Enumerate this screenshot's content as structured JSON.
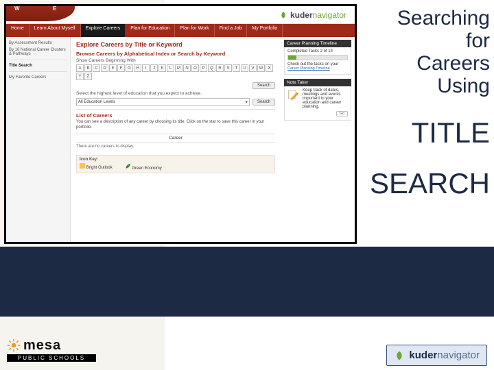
{
  "brand": {
    "name": "kuder",
    "suffix": "navigator"
  },
  "nav": {
    "tabs": [
      {
        "label": "Home"
      },
      {
        "label": "Learn About Myself"
      },
      {
        "label": "Explore Careers",
        "active": true
      },
      {
        "label": "Plan for Education"
      },
      {
        "label": "Plan for Work"
      },
      {
        "label": "Find a Job"
      },
      {
        "label": "My Portfolio"
      }
    ]
  },
  "sidebar": {
    "items": [
      "By Assessment Results",
      "By 16 National Career Clusters & Pathways",
      "Title Search",
      "My Favorite Careers"
    ]
  },
  "main": {
    "title": "Explore Careers by Title or Keyword",
    "browse_head": "Browse Careers by Alphabetical Index or Search by Keyword",
    "show_label": "Show Careers Beginning With",
    "letters": [
      "A",
      "B",
      "C",
      "D",
      "E",
      "F",
      "G",
      "H",
      "I",
      "J",
      "K",
      "L",
      "M",
      "N",
      "O",
      "P",
      "Q",
      "R",
      "S",
      "T",
      "U",
      "V",
      "W",
      "X",
      "Y",
      "Z"
    ],
    "search_btn": "Search",
    "edu_label": "Select the highest level of education that you expect to achieve.",
    "edu_selected": "All Education Levels",
    "list_title": "List of Careers",
    "list_desc": "You can see a description of any career by choosing its title. Click on the star to save this career in your portfolio.",
    "col_career": "Career",
    "empty_msg": "There are no careers to display.",
    "icon_key_title": "Icon Key:",
    "bo_label": "Bright Outlook",
    "ge_label": "Green Economy"
  },
  "right": {
    "planning_head": "Career Planning Timeline",
    "completed_label": "Completed Tasks 2 of 14",
    "progress_pct": 14,
    "planning_desc": "Check out the tasks on your",
    "planning_link": "Career Planning Timeline",
    "note_head": "Note Taker",
    "note_desc": "Keep track of dates, meetings and events important to your education and career planning.",
    "go_label": "Go"
  },
  "slide_text": {
    "l1": "Searching",
    "l2": "for",
    "l3": "Careers",
    "l4": "Using",
    "big1": "TITLE",
    "big2": "SEARCH"
  },
  "footer": {
    "mesa_word": "mesa",
    "mesa_sub": "PUBLIC SCHOOLS",
    "kuder": "kuder",
    "kuder_suffix": "navigator"
  }
}
